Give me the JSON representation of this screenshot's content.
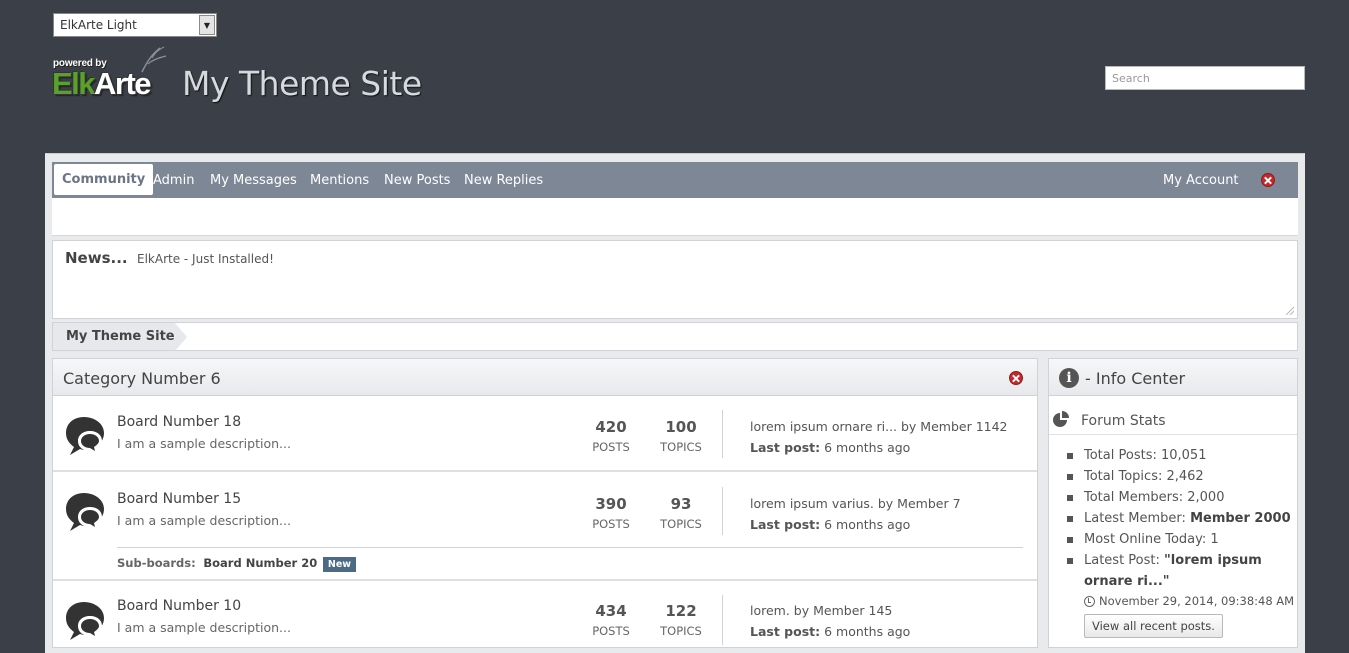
{
  "header": {
    "theme_select": "ElkArte Light",
    "logo_powered": "powered by",
    "logo_elk": "Elk",
    "logo_arte": "Arte",
    "site_title": "My Theme Site",
    "search_placeholder": "Search"
  },
  "menu": {
    "items": [
      "Community",
      "Admin",
      "My Messages",
      "Mentions",
      "New Posts",
      "New Replies"
    ],
    "account": "My Account"
  },
  "news": {
    "label": "News...",
    "text": "ElkArte - Just Installed!"
  },
  "breadcrumb": "My Theme Site",
  "category": {
    "title": "Category Number 6",
    "boards": [
      {
        "name": "Board Number 18",
        "desc": "I am a sample description...",
        "posts": "420",
        "posts_label": "POSTS",
        "topics": "100",
        "topics_label": "TOPICS",
        "last_title": "lorem ipsum ornare ri... by Member 1142",
        "last_label": "Last post:",
        "last_time": "6 months ago"
      },
      {
        "name": "Board Number 15",
        "desc": "I am a sample description...",
        "posts": "390",
        "posts_label": "POSTS",
        "topics": "93",
        "topics_label": "TOPICS",
        "last_title": "lorem ipsum varius. by Member 7",
        "last_label": "Last post:",
        "last_time": "6 months ago",
        "subboards_label": "Sub-boards:",
        "subboard": "Board Number 20",
        "subboard_badge": "New"
      },
      {
        "name": "Board Number 10",
        "desc": "I am a sample description...",
        "posts": "434",
        "posts_label": "POSTS",
        "topics": "122",
        "topics_label": "TOPICS",
        "last_title": "lorem. by Member 145",
        "last_label": "Last post:",
        "last_time": "6 months ago"
      }
    ]
  },
  "info": {
    "title": "- Info Center",
    "section": "Forum Stats",
    "stats": {
      "posts": "Total Posts: 10,051",
      "topics": "Total Topics: 2,462",
      "members": "Total Members: 2,000",
      "latest_member_label": "Latest Member: ",
      "latest_member": "Member 2000",
      "online": "Most Online Today: 1",
      "latest_post_label": "Latest Post: ",
      "latest_post": "\"lorem ipsum ornare ri...\""
    },
    "post_time": "November 29, 2014, 09:38:48 AM",
    "view_all": "View all recent posts."
  }
}
